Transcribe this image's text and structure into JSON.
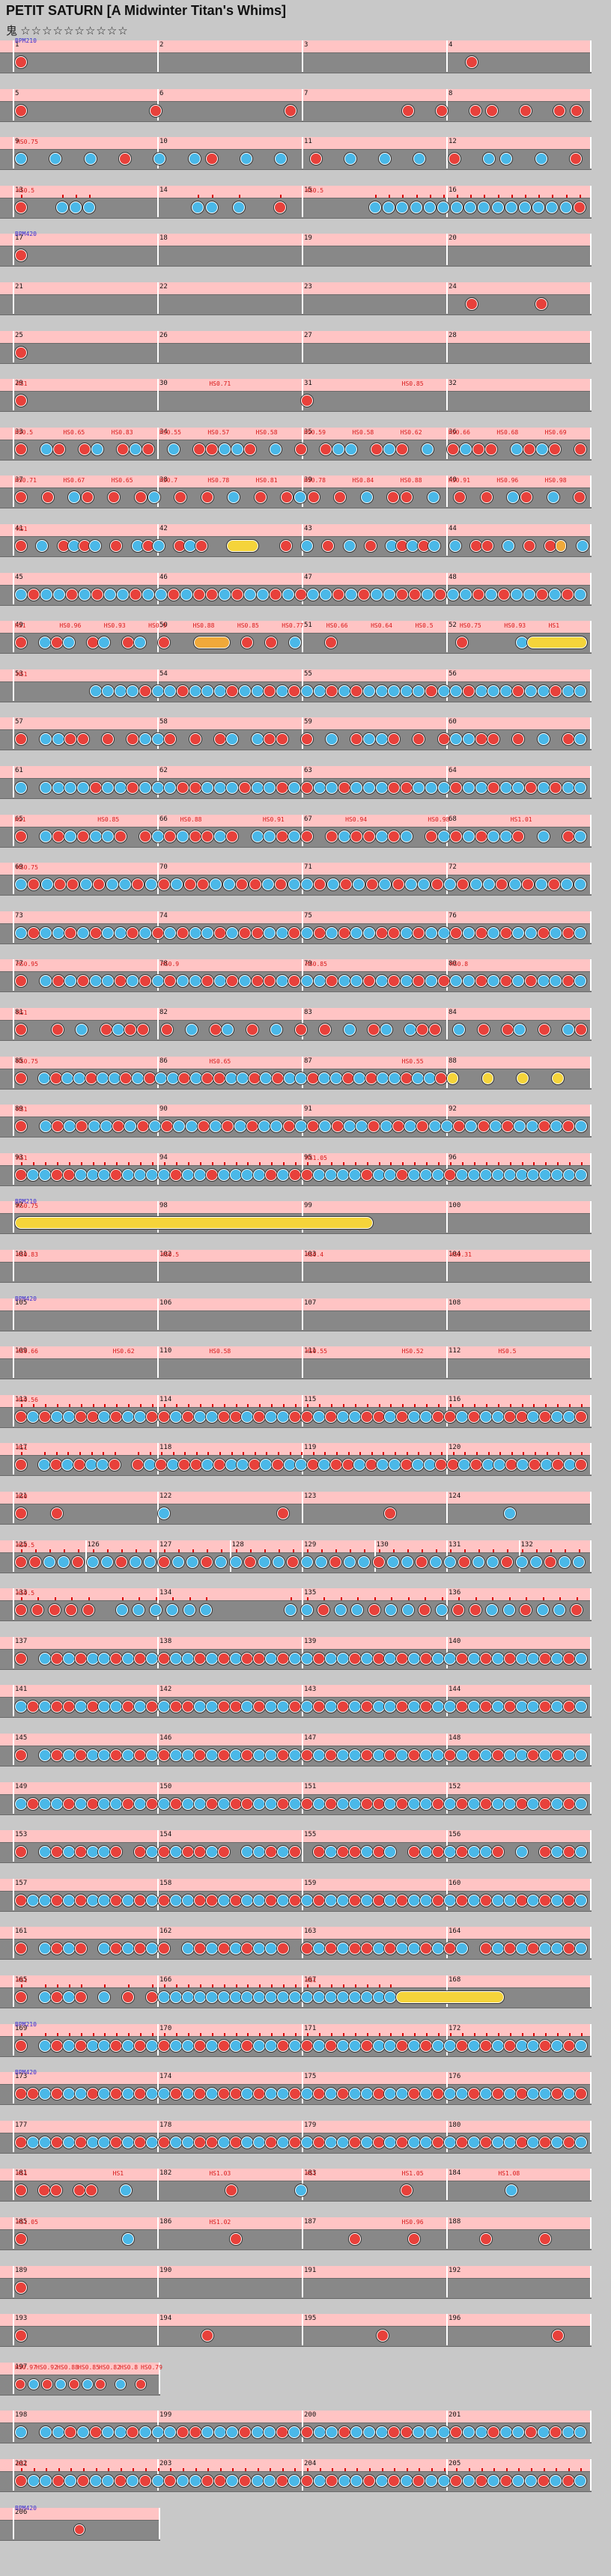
{
  "header": {
    "title": "PETIT SATURN [A Midwinter Titan's Whims]",
    "difficulty_label": "鬼",
    "stars": "☆☆☆☆☆☆☆☆☆☆"
  },
  "legend": {
    "don_color": "#e8413b",
    "ka_color": "#4ab8e8",
    "drumroll_color": "#f5d43a",
    "balloon_color": "#f0a93a",
    "lane_color": "#888888",
    "gogo_color": "#ffc4c4"
  },
  "rows": [
    {
      "measures": [
        "1",
        "2",
        "3",
        "4"
      ],
      "bpm": "BPM210",
      "marks": "",
      "hs": [],
      "pattern": "D.........................D......"
    },
    {
      "measures": [
        "5",
        "6",
        "7",
        "8"
      ],
      "bpm": "",
      "marks": "",
      "hs": [],
      "pattern": "D.......D.......D......D.D.DD.D.DD"
    },
    {
      "measures": [
        "9",
        "10",
        "11",
        "12"
      ],
      "bpm": "",
      "marks": "",
      "hs": [
        "HS0.75"
      ],
      "pattern": "K.K.K.D.K.KD.K.K.D.K.K.K.D.KK.K.D"
    },
    {
      "measures": [
        "13",
        "14",
        "15",
        "16"
      ],
      "bpm": "",
      "marks": "dense4",
      "hs": [
        "HS0.5",
        "HS0.5"
      ],
      "pattern": "D..KKK.......KK.K..D......KKKKKKKKKKKKKKKD"
    },
    {
      "measures": [
        "17",
        "18",
        "19",
        "20"
      ],
      "bpm": "BPM420",
      "marks": "",
      "hs": [],
      "pattern": "D..........................................."
    },
    {
      "measures": [
        "21",
        "22",
        "23",
        "24"
      ],
      "bpm": "",
      "marks": "",
      "hs": [],
      "pattern": "..........................D...D.."
    },
    {
      "measures": [
        "25",
        "26",
        "27",
        "28"
      ],
      "bpm": "",
      "marks": "",
      "hs": [],
      "pattern": "D..............................."
    },
    {
      "measures": [
        "29",
        "30",
        "31",
        "32"
      ],
      "bpm": "",
      "marks": "",
      "hs": [
        "HS1",
        "HS0.71",
        "HS0.85"
      ],
      "pattern": "D...............D..............."
    },
    {
      "measures": [
        "33",
        "34",
        "35",
        "36"
      ],
      "bpm": "",
      "marks": "",
      "hs": [
        "HS0.5",
        "HS0.65",
        "HS0.83",
        "HS0.55",
        "HS0.57",
        "HS0.58",
        "HS0.59",
        "HS0.58",
        "HS0.62",
        "HS0.66",
        "HS0.68",
        "HS0.69"
      ],
      "pattern": "D.KD.DK.DKD.K.DDKKD.K.D.DKK.DKD.K.DKDD.KDKD.D"
    },
    {
      "measures": [
        "37",
        "38",
        "39",
        "40"
      ],
      "bpm": "",
      "marks": "",
      "hs": [
        "HS0.71",
        "HS0.67",
        "HS0.65",
        "HS0.7",
        "HS0.78",
        "HS0.81",
        "HS0.78",
        "HS0.84",
        "HS0.88",
        "HS0.91",
        "HS0.96",
        "HS0.98"
      ],
      "pattern": "D.D.KD.D.DK.D.D.K.D.DKD.D.K.DD.K.D.D.KD.K.D"
    },
    {
      "measures": [
        "41",
        "42",
        "43",
        "44"
      ],
      "bpm": "",
      "marks": "",
      "hs": [
        "HS1"
      ],
      "pattern": "D.K.DKDK.D.KDK.DKD..YYY..D.K.D.K.D.KDKDK.K.DD.K.D.DO.K"
    },
    {
      "measures": [
        "45",
        "46",
        "47",
        "48"
      ],
      "bpm": "",
      "marks": "",
      "hs": [],
      "pattern": "KDKKDKDKKDKKDKDDKDKKDKDKKDKDKKDDKDKKDKDKKDKDK"
    },
    {
      "measures": [
        "49",
        "50",
        "51",
        "52"
      ],
      "bpm": "",
      "marks": "",
      "hs": [
        "HS1",
        "HS0.96",
        "HS0.93",
        "HS0.9",
        "HS0.88",
        "HS0.85",
        "HS0.77",
        "HS0.66",
        "HS0.64",
        "HS0.5",
        "HS0.75",
        "HS0.93",
        "HS1"
      ],
      "pattern": "D.KDK.DK.DK.D..OOO.D.D.K..D..........D....KYYYYY"
    },
    {
      "measures": [
        "53",
        "54",
        "55",
        "56"
      ],
      "bpm": "",
      "marks": "",
      "hs": [
        "HS1"
      ],
      "pattern": "......KKKKDKKDKKKDKKDKDKKDKDKKKKKDKKDKKKDKKDKK"
    },
    {
      "measures": [
        "57",
        "58",
        "59",
        "60"
      ],
      "bpm": "",
      "marks": "",
      "hs": [],
      "pattern": "D.KKDD.D.DKKD.D.DK.KDD.D.K.DKKD.D.DKKDD.D.K.DK"
    },
    {
      "measures": [
        "61",
        "62",
        "63",
        "64"
      ],
      "bpm": "",
      "marks": "",
      "hs": [],
      "pattern": "K.KKKKDKKDKKKDDKKKDKKDKDKKDKKKDDKKKDKKDKKDKDKK"
    },
    {
      "measures": [
        "65",
        "66",
        "67",
        "68"
      ],
      "bpm": "",
      "marks": "",
      "hs": [
        "HS1",
        "HS0.85",
        "HS0.88",
        "HS0.91",
        "HS0.94",
        "HS0.98",
        "HS1.01"
      ],
      "pattern": "D.KDKDKKD.DKDKDDKD.KKDKD.DKDDKDK.DKDKDKKD.K.DK"
    },
    {
      "measures": [
        "69",
        "70",
        "71",
        "72"
      ],
      "bpm": "",
      "marks": "",
      "hs": [
        "HS0.75"
      ],
      "pattern": "KDKDDKDKKDKDKDDKKDDKDKKDKDKDKDKKDKDKKDKDKDKK"
    },
    {
      "measures": [
        "73",
        "74",
        "75",
        "76"
      ],
      "bpm": "",
      "marks": "",
      "hs": [],
      "pattern": "KDKKDKDKKDKDKDKKDKDDKKDKDKDKKDDKDKKDKDKDKKDKDK"
    },
    {
      "measures": [
        "77",
        "78",
        "79",
        "80"
      ],
      "bpm": "",
      "marks": "",
      "hs": [
        "HS0.95",
        "HS0.9",
        "HS0.85",
        "HS0.8"
      ],
      "pattern": "D.KDKDKKDKDKDKKDKDKDDKDKKDKKDKDKDKDKKDKDKDKKDK"
    },
    {
      "measures": [
        "81",
        "82",
        "83",
        "84"
      ],
      "bpm": "",
      "marks": "",
      "hs": [
        "HS1"
      ],
      "pattern": "D..D.K.DKDD.D.K.DK.D.K.D.D.K.DK.KDD.K.D.DK.D.KD"
    },
    {
      "measures": [
        "85",
        "86",
        "87",
        "88"
      ],
      "bpm": "",
      "marks": "",
      "hs": [
        "HS0.75",
        "HS0.65",
        "HS0.55"
      ],
      "pattern": "D.KDKKDKKDKDKKDKDDKKDKDKKDKKDKDKKDKKDY..Y..Y..Y.."
    },
    {
      "measures": [
        "89",
        "90",
        "91",
        "92"
      ],
      "bpm": "",
      "marks": "",
      "hs": [
        "HS1"
      ],
      "pattern": "D.KDKDKKDKDKDKKDKDKDKKDKDKDKKDKDKDKKDKDKDKKDKDK"
    },
    {
      "measures": [
        "93",
        "94",
        "95",
        "96"
      ],
      "bpm": "",
      "marks": "dense",
      "hs": [
        "HS1",
        "HS1.05"
      ],
      "pattern": "DKKDDKKKDKKKKDKKDKKKKDKDDKKKKDKKDKKKDKKKKKKKKKKK"
    },
    {
      "measures": [
        "97",
        "98",
        "99",
        "100"
      ],
      "bpm": "BPM210",
      "marks": "",
      "hs": [
        "HS0.75"
      ],
      "pattern": "YYYYYYYYYYYYYYYYYYYYYYYYYYYYYY.................."
    },
    {
      "measures": [
        "101",
        "102",
        "103",
        "104"
      ],
      "bpm": "",
      "marks": "",
      "hs": [
        "HS0.83",
        "HS0.5",
        "HS0.4",
        "HS0.31"
      ],
      "pattern": "................................................"
    },
    {
      "measures": [
        "105",
        "106",
        "107",
        "108"
      ],
      "bpm": "BPM420",
      "marks": "",
      "hs": [],
      "pattern": "................................................"
    },
    {
      "measures": [
        "109",
        "110",
        "111",
        "112"
      ],
      "bpm": "",
      "marks": "",
      "hs": [
        "HS0.66",
        "HS0.62",
        "HS0.58",
        "HS0.55",
        "HS0.52",
        "HS0.5"
      ],
      "pattern": "................................................"
    },
    {
      "measures": [
        "113",
        "114",
        "115",
        "116"
      ],
      "bpm": "",
      "marks": "dense",
      "hs": [
        "HS0.56"
      ],
      "pattern": "DKDKKDDKDKKDDKDKKDDKDKKDDKDKKDDKDKKDDKDKKDDKDKKD"
    },
    {
      "measures": [
        "117",
        "118",
        "119",
        "120"
      ],
      "bpm": "",
      "marks": "dense4",
      "hs": [
        "HS1"
      ],
      "pattern": "D.KDKDKKD.DKDKDDKDKKDKDKKDKDDKDKKDKKDDKDKKDKDKDKD"
    },
    {
      "measures": [
        "121",
        "122",
        "123",
        "124"
      ],
      "bpm": "",
      "marks": "",
      "hs": [
        "HS0"
      ],
      "pattern": "D..D........K.........D........D.........K......"
    },
    {
      "measures": [
        "125",
        "126",
        "127",
        "128",
        "129",
        "130",
        "131",
        "132"
      ],
      "bpm": "",
      "marks": "dense",
      "hs": [
        "HS0.5"
      ],
      "pattern": "DDKKDKKDKKDKKDKKDKKDKKDKKDKKDKKDKKDKKDKK"
    },
    {
      "measures": [
        "133",
        "134",
        "135",
        "136"
      ],
      "bpm": "",
      "marks": "dense",
      "hs": [
        "HS0.5"
      ],
      "pattern": "DDDDD.KKKKKK....KKDKKDKKDKDDKKDKKD"
    },
    {
      "measures": [
        "137",
        "138",
        "139",
        "140"
      ],
      "bpm": "",
      "marks": "",
      "hs": [],
      "pattern": "D.KDKDKKDKDKDKKDKDKDDKDKKDKKDKDKDKDKKDKDKDKKDKDK"
    },
    {
      "measures": [
        "141",
        "142",
        "143",
        "144"
      ],
      "bpm": "",
      "marks": "",
      "hs": [],
      "pattern": "KDKDDKDKKDKDKDDKKDDKDKKDKDKDKDKKDKDKKDKDKDKKDKDK"
    },
    {
      "measures": [
        "145",
        "146",
        "147",
        "148"
      ],
      "bpm": "",
      "marks": "",
      "hs": [],
      "pattern": "D.KDKDKKDKDKDKKDKDKDKKDKDKDKKDKDKDKKDKDKDKKDKDKK"
    },
    {
      "measures": [
        "149",
        "150",
        "151",
        "152"
      ],
      "bpm": "",
      "marks": "",
      "hs": [],
      "pattern": "KDKKDKDKKDKDKDKKDKDDKKDKDKDKKDDKDKKDKDKDKKDKDKDK"
    },
    {
      "measures": [
        "153",
        "154",
        "155",
        "156"
      ],
      "bpm": "",
      "marks": "",
      "hs": [],
      "pattern": "D.KDKDKKD.DKDKDDKD.KKDKD.DKDDKDK.DKDKDKKD.K.DKDK"
    },
    {
      "measures": [
        "157",
        "158",
        "159",
        "160"
      ],
      "bpm": "",
      "marks": "",
      "hs": [],
      "pattern": "DKKDKDKKDKDKDKKDDKDKKDKDKDKKDKDKDKKDKDKDKKDKDKDK"
    },
    {
      "measures": [
        "161",
        "162",
        "163",
        "164"
      ],
      "bpm": "",
      "marks": "",
      "hs": [],
      "pattern": "D.KDKD.KDKDKD.KDKDKDKKD.DKDKDDKDKKDKDK.DKDKDKKDK"
    },
    {
      "measures": [
        "165",
        "166",
        "167",
        "168"
      ],
      "bpm": "",
      "marks": "dense",
      "hs": [
        "HS1",
        "HS1"
      ],
      "pattern": "D.KDKD.K.D.DKKKKKKKKKKKKKKKKKKKKYYYYYYYYY......."
    },
    {
      "measures": [
        "169",
        "170",
        "171",
        "172"
      ],
      "bpm": "BPM210",
      "marks": "dense",
      "hs": [],
      "pattern": "D.KDKDKKDKDKDKKDKDKDKKDKDKDKKDKKDKDKKDKDKDKKDKDK"
    },
    {
      "measures": [
        "173",
        "174",
        "175",
        "176"
      ],
      "bpm": "BPM420",
      "marks": "",
      "hs": [],
      "pattern": "DDKDKKDKDKDKKDKDKDDKDKKDKDKDKKDKKDKDKKDKDKDKKDKD"
    },
    {
      "measures": [
        "177",
        "178",
        "179",
        "180"
      ],
      "bpm": "",
      "marks": "",
      "hs": [],
      "pattern": "DKKDKDKKDKDKDKKDDKDKKDKDKDKKDKDKDKKDKDKDKKDKDKDK"
    },
    {
      "measures": [
        "181",
        "182",
        "183",
        "184"
      ],
      "bpm": "",
      "marks": "",
      "hs": [
        "HS1",
        "HS1",
        "HS1.03",
        "HS1",
        "HS1.05",
        "HS1.08"
      ],
      "pattern": "D.DD.DD..K........D.....K........D........K......"
    },
    {
      "measures": [
        "185",
        "186",
        "187",
        "188"
      ],
      "bpm": "",
      "marks": "",
      "hs": [
        "HS1.05",
        "HS1.02",
        "HS0.96"
      ],
      "pattern": "D........K........D.........D....D.....D....D..."
    },
    {
      "measures": [
        "189",
        "190",
        "191",
        "192"
      ],
      "bpm": "",
      "marks": "",
      "hs": [],
      "pattern": "D.............................................."
    },
    {
      "measures": [
        "193",
        "194",
        "195",
        "196"
      ],
      "bpm": "",
      "marks": "",
      "hs": [],
      "pattern": "D...............D..............D..............D.."
    },
    {
      "measures": [
        "197"
      ],
      "bpm": "",
      "marks": "",
      "hs": [
        "HS0.97",
        "HS0.92",
        "HS0.88",
        "HS0.85",
        "HS0.82",
        "HS0.8",
        "HS0.79"
      ],
      "pattern": "D.K.D.K.D.K.D..K..D.."
    },
    {
      "measures": [
        "198",
        "199",
        "200",
        "201"
      ],
      "bpm": "",
      "marks": "",
      "hs": [],
      "pattern": "K.KKDKDKKDKKKDDKKKDKKDKDKKDKKKDDKKKDKKDKKDKDKK"
    },
    {
      "measures": [
        "202",
        "203",
        "204",
        "205"
      ],
      "bpm": "",
      "marks": "dense",
      "hs": [
        "HS1"
      ],
      "pattern": "DKKDKDKKDKDKDKKDDKDKKDKDKDKKDKDKDKKDKDKDKKDKDK"
    },
    {
      "measures": [
        "206"
      ],
      "bpm": "BPM420",
      "marks": "",
      "hs": [],
      "pattern": "........D.........."
    }
  ]
}
